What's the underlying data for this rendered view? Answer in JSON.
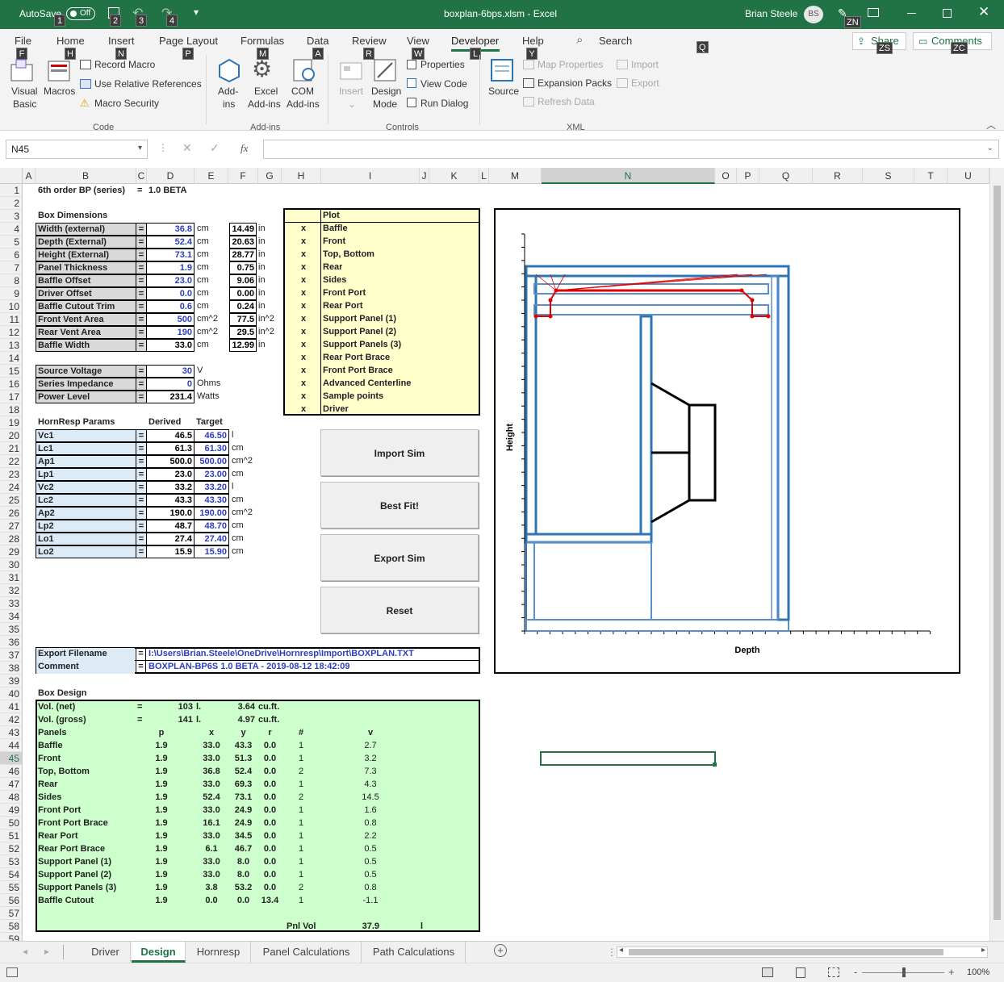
{
  "titlebar": {
    "autosave_label": "AutoSave",
    "autosave_state": "Off",
    "filename": "boxplan-6bps.xlsm - Excel",
    "user": "Brian Steele",
    "initials": "BS",
    "keytips": [
      "1",
      "2",
      "3",
      "4",
      "ZN"
    ]
  },
  "ribbon": {
    "tabs": [
      "File",
      "Home",
      "Insert",
      "Page Layout",
      "Formulas",
      "Data",
      "Review",
      "View",
      "Developer",
      "Help"
    ],
    "tab_keytips": [
      "F",
      "H",
      "N",
      "P",
      "M",
      "A",
      "R",
      "W",
      "L",
      "Y"
    ],
    "search": "Search",
    "search_keytip": "Q",
    "share": "Share",
    "share_keytip": "ZS",
    "comments": "Comments",
    "comments_keytip": "ZC",
    "code": {
      "visual_basic": "Visual",
      "visual_basic2": "Basic",
      "macros": "Macros",
      "record": "Record Macro",
      "relative": "Use Relative References",
      "security": "Macro Security",
      "group": "Code"
    },
    "addins": {
      "addins1": "Add-",
      "addins2": "ins",
      "excel1": "Excel",
      "excel2": "Add-ins",
      "com1": "COM",
      "com2": "Add-ins",
      "group": "Add-ins"
    },
    "controls": {
      "insert": "Insert",
      "design1": "Design",
      "design2": "Mode",
      "properties": "Properties",
      "viewcode": "View Code",
      "rundialog": "Run Dialog",
      "group": "Controls"
    },
    "xml": {
      "source": "Source",
      "mapprops": "Map Properties",
      "import": "Import",
      "expansion": "Expansion Packs",
      "export": "Export",
      "refresh": "Refresh Data",
      "group": "XML"
    }
  },
  "formula_bar": {
    "name_box": "N45",
    "fx": "fx",
    "value": ""
  },
  "columns": [
    "A",
    "B",
    "C",
    "D",
    "E",
    "F",
    "G",
    "H",
    "I",
    "J",
    "K",
    "L",
    "M",
    "N",
    "O",
    "P",
    "Q",
    "R",
    "S",
    "T",
    "U"
  ],
  "rows": [
    "1",
    "2",
    "3",
    "4",
    "5",
    "6",
    "7",
    "8",
    "9",
    "10",
    "11",
    "12",
    "13",
    "14",
    "15",
    "16",
    "17",
    "18",
    "19",
    "20",
    "21",
    "22",
    "23",
    "24",
    "25",
    "26",
    "27",
    "28",
    "29",
    "30",
    "31",
    "32",
    "33",
    "34",
    "35",
    "36",
    "37",
    "38",
    "39",
    "40",
    "41",
    "42",
    "43",
    "44",
    "45",
    "46",
    "47",
    "48",
    "49",
    "50",
    "51",
    "52",
    "53",
    "54",
    "55",
    "56",
    "57",
    "58",
    "59"
  ],
  "sheet": {
    "title": "6th order BP (series)",
    "title_eq": "=",
    "title_ver": "1.0 BETA",
    "box_dim_header": "Box Dimensions",
    "dims": [
      {
        "label": "Width (external)",
        "v": "36.8",
        "u": "cm",
        "v2": "14.49",
        "u2": "in"
      },
      {
        "label": "Depth (External)",
        "v": "52.4",
        "u": "cm",
        "v2": "20.63",
        "u2": "in"
      },
      {
        "label": "Height (External)",
        "v": "73.1",
        "u": "cm",
        "v2": "28.77",
        "u2": "in"
      },
      {
        "label": "Panel Thickness",
        "v": "1.9",
        "u": "cm",
        "v2": "0.75",
        "u2": "in"
      },
      {
        "label": "Baffle Offset",
        "v": "23.0",
        "u": "cm",
        "v2": "9.06",
        "u2": "in"
      },
      {
        "label": "Driver Offset",
        "v": "0.0",
        "u": "cm",
        "v2": "0.00",
        "u2": "in"
      },
      {
        "label": "Baffle Cutout Trim",
        "v": "0.6",
        "u": "cm",
        "v2": "0.24",
        "u2": "in"
      },
      {
        "label": "Front Vent Area",
        "v": "500",
        "u": "cm^2",
        "v2": "77.5",
        "u2": "in^2"
      },
      {
        "label": "Rear Vent Area",
        "v": "190",
        "u": "cm^2",
        "v2": "29.5",
        "u2": "in^2"
      },
      {
        "label": "Baffle Width",
        "v": "33.0",
        "u": "cm",
        "v2": "12.99",
        "u2": "in",
        "black": true
      }
    ],
    "power": [
      {
        "label": "Source Voltage",
        "v": "30",
        "u": "V",
        "blue": true
      },
      {
        "label": "Series Impedance",
        "v": "0",
        "u": "Ohms",
        "blue": true
      },
      {
        "label": "Power Level",
        "v": "231.4",
        "u": "Watts",
        "blue": false
      }
    ],
    "horn_header": "HornResp Params",
    "derived": "Derived",
    "target": "Target",
    "horn": [
      {
        "label": "Vc1",
        "d": "46.5",
        "t": "46.50",
        "u": "l"
      },
      {
        "label": "Lc1",
        "d": "61.3",
        "t": "61.30",
        "u": "cm"
      },
      {
        "label": "Ap1",
        "d": "500.0",
        "t": "500.00",
        "u": "cm^2"
      },
      {
        "label": "Lp1",
        "d": "23.0",
        "t": "23.00",
        "u": "cm"
      },
      {
        "label": "Vc2",
        "d": "33.2",
        "t": "33.20",
        "u": "l"
      },
      {
        "label": "Lc2",
        "d": "43.3",
        "t": "43.30",
        "u": "cm"
      },
      {
        "label": "Ap2",
        "d": "190.0",
        "t": "190.00",
        "u": "cm^2"
      },
      {
        "label": "Lp2",
        "d": "48.7",
        "t": "48.70",
        "u": "cm"
      },
      {
        "label": "Lo1",
        "d": "27.4",
        "t": "27.40",
        "u": "cm"
      },
      {
        "label": "Lo2",
        "d": "15.9",
        "t": "15.90",
        "u": "cm"
      }
    ],
    "plot_header": "Plot",
    "plot_items": [
      "Baffle",
      "Front",
      "Top, Bottom",
      "Rear",
      "Sides",
      "Front Port",
      "Rear Port",
      "Support Panel (1)",
      "Support Panel (2)",
      "Support Panels (3)",
      "Rear Port Brace",
      "Front Port Brace",
      "Advanced Centerline",
      "Sample points",
      "Driver"
    ],
    "plot_mark": "x",
    "buttons": [
      "Import Sim",
      "Best Fit!",
      "Export Sim",
      "Reset"
    ],
    "export_label": "Export Filename",
    "export_value": "I:\\Users\\Brian.Steele\\OneDrive\\Hornresp\\Import\\BOXPLAN.TXT",
    "comment_label": "Comment",
    "comment_value": "BOXPLAN-BP6S 1.0 BETA - 2019-08-12 18:42:09",
    "box_design_header": "Box Design",
    "vol": [
      {
        "label": "Vol. (net)",
        "eq": "=",
        "v": "103",
        "u": "l.",
        "v2": "3.64",
        "u2": "cu.ft."
      },
      {
        "label": "Vol. (gross)",
        "eq": "=",
        "v": "141",
        "u": "l.",
        "v2": "4.97",
        "u2": "cu.ft."
      }
    ],
    "panel_headers": {
      "name": "Panels",
      "p": "p",
      "x": "x",
      "y": "y",
      "r": "r",
      "n": "#",
      "v": "v"
    },
    "panels": [
      {
        "name": "Baffle",
        "p": "1.9",
        "x": "33.0",
        "y": "43.3",
        "r": "0.0",
        "n": "1",
        "v": "2.7"
      },
      {
        "name": "Front",
        "p": "1.9",
        "x": "33.0",
        "y": "51.3",
        "r": "0.0",
        "n": "1",
        "v": "3.2"
      },
      {
        "name": "Top, Bottom",
        "p": "1.9",
        "x": "36.8",
        "y": "52.4",
        "r": "0.0",
        "n": "2",
        "v": "7.3"
      },
      {
        "name": "Rear",
        "p": "1.9",
        "x": "33.0",
        "y": "69.3",
        "r": "0.0",
        "n": "1",
        "v": "4.3"
      },
      {
        "name": "Sides",
        "p": "1.9",
        "x": "52.4",
        "y": "73.1",
        "r": "0.0",
        "n": "2",
        "v": "14.5"
      },
      {
        "name": "Front Port",
        "p": "1.9",
        "x": "33.0",
        "y": "24.9",
        "r": "0.0",
        "n": "1",
        "v": "1.6"
      },
      {
        "name": "Front Port Brace",
        "p": "1.9",
        "x": "16.1",
        "y": "24.9",
        "r": "0.0",
        "n": "1",
        "v": "0.8"
      },
      {
        "name": "Rear Port",
        "p": "1.9",
        "x": "33.0",
        "y": "34.5",
        "r": "0.0",
        "n": "1",
        "v": "2.2"
      },
      {
        "name": "Rear Port Brace",
        "p": "1.9",
        "x": "6.1",
        "y": "46.7",
        "r": "0.0",
        "n": "1",
        "v": "0.5"
      },
      {
        "name": "Support Panel (1)",
        "p": "1.9",
        "x": "33.0",
        "y": "8.0",
        "r": "0.0",
        "n": "1",
        "v": "0.5"
      },
      {
        "name": "Support Panel (2)",
        "p": "1.9",
        "x": "33.0",
        "y": "8.0",
        "r": "0.0",
        "n": "1",
        "v": "0.5"
      },
      {
        "name": "Support Panels (3)",
        "p": "1.9",
        "x": "3.8",
        "y": "53.2",
        "r": "0.0",
        "n": "2",
        "v": "0.8"
      },
      {
        "name": "Baffle Cutout",
        "p": "1.9",
        "x": "0.0",
        "y": "0.0",
        "r": "13.4",
        "n": "1",
        "v": "-1.1"
      }
    ],
    "pnl_vol_label": "Pnl Vol",
    "pnl_vol": "37.9",
    "pnl_vol_unit": "l",
    "chart": {
      "xlabel": "Depth",
      "ylabel": "Height"
    }
  },
  "sheet_tabs": [
    "Driver",
    "Design",
    "Hornresp",
    "Panel Calculations",
    "Path Calculations"
  ],
  "active_tab": "Design",
  "status": {
    "zoom": "100%",
    "minus": "-",
    "plus": "+"
  }
}
